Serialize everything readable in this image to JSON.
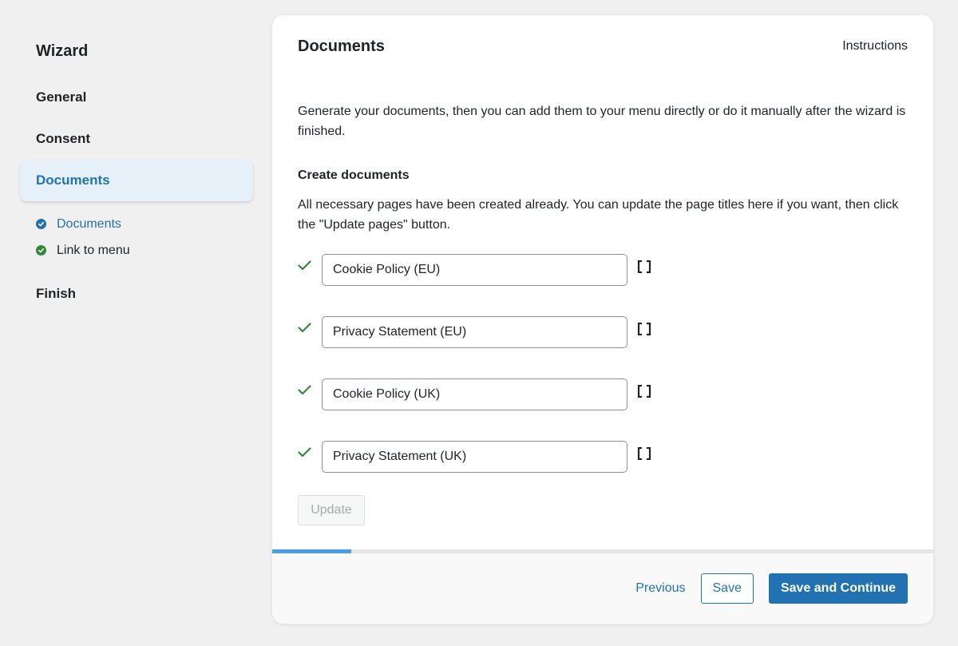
{
  "sidebar": {
    "title": "Wizard",
    "items": [
      {
        "label": "General",
        "active": false
      },
      {
        "label": "Consent",
        "active": false
      },
      {
        "label": "Documents",
        "active": true
      },
      {
        "label": "Finish",
        "active": false
      }
    ],
    "subitems": [
      {
        "label": "Documents",
        "icon": "check-circle-icon",
        "color": "#2271b1",
        "current": true
      },
      {
        "label": "Link to menu",
        "icon": "check-circle-icon",
        "color": "#2e8a37",
        "current": false
      }
    ]
  },
  "main": {
    "title": "Documents",
    "instructions_label": "Instructions",
    "intro": "Generate your documents, then you can add them to your menu directly or do it manually after the wizard is finished.",
    "section_title": "Create documents",
    "section_desc": "All necessary pages have been created already. You can update the page titles here if you want, then click the \"Update pages\" button.",
    "documents": [
      {
        "value": "Cookie Policy (EU)",
        "status_icon": "checkmark-icon",
        "action_icon": "shortcode-icon"
      },
      {
        "value": "Privacy Statement (EU)",
        "status_icon": "checkmark-icon",
        "action_icon": "shortcode-icon"
      },
      {
        "value": "Cookie Policy (UK)",
        "status_icon": "checkmark-icon",
        "action_icon": "shortcode-icon"
      },
      {
        "value": "Privacy Statement (UK)",
        "status_icon": "checkmark-icon",
        "action_icon": "shortcode-icon"
      }
    ],
    "update_label": "Update"
  },
  "progress": {
    "value": 0.12,
    "color": "#4a9ee8"
  },
  "footer": {
    "previous_label": "Previous",
    "save_label": "Save",
    "save_continue_label": "Save and Continue"
  },
  "colors": {
    "accent": "#2271b1",
    "success": "#2e8a37",
    "active_bg": "#e5f0f9"
  }
}
